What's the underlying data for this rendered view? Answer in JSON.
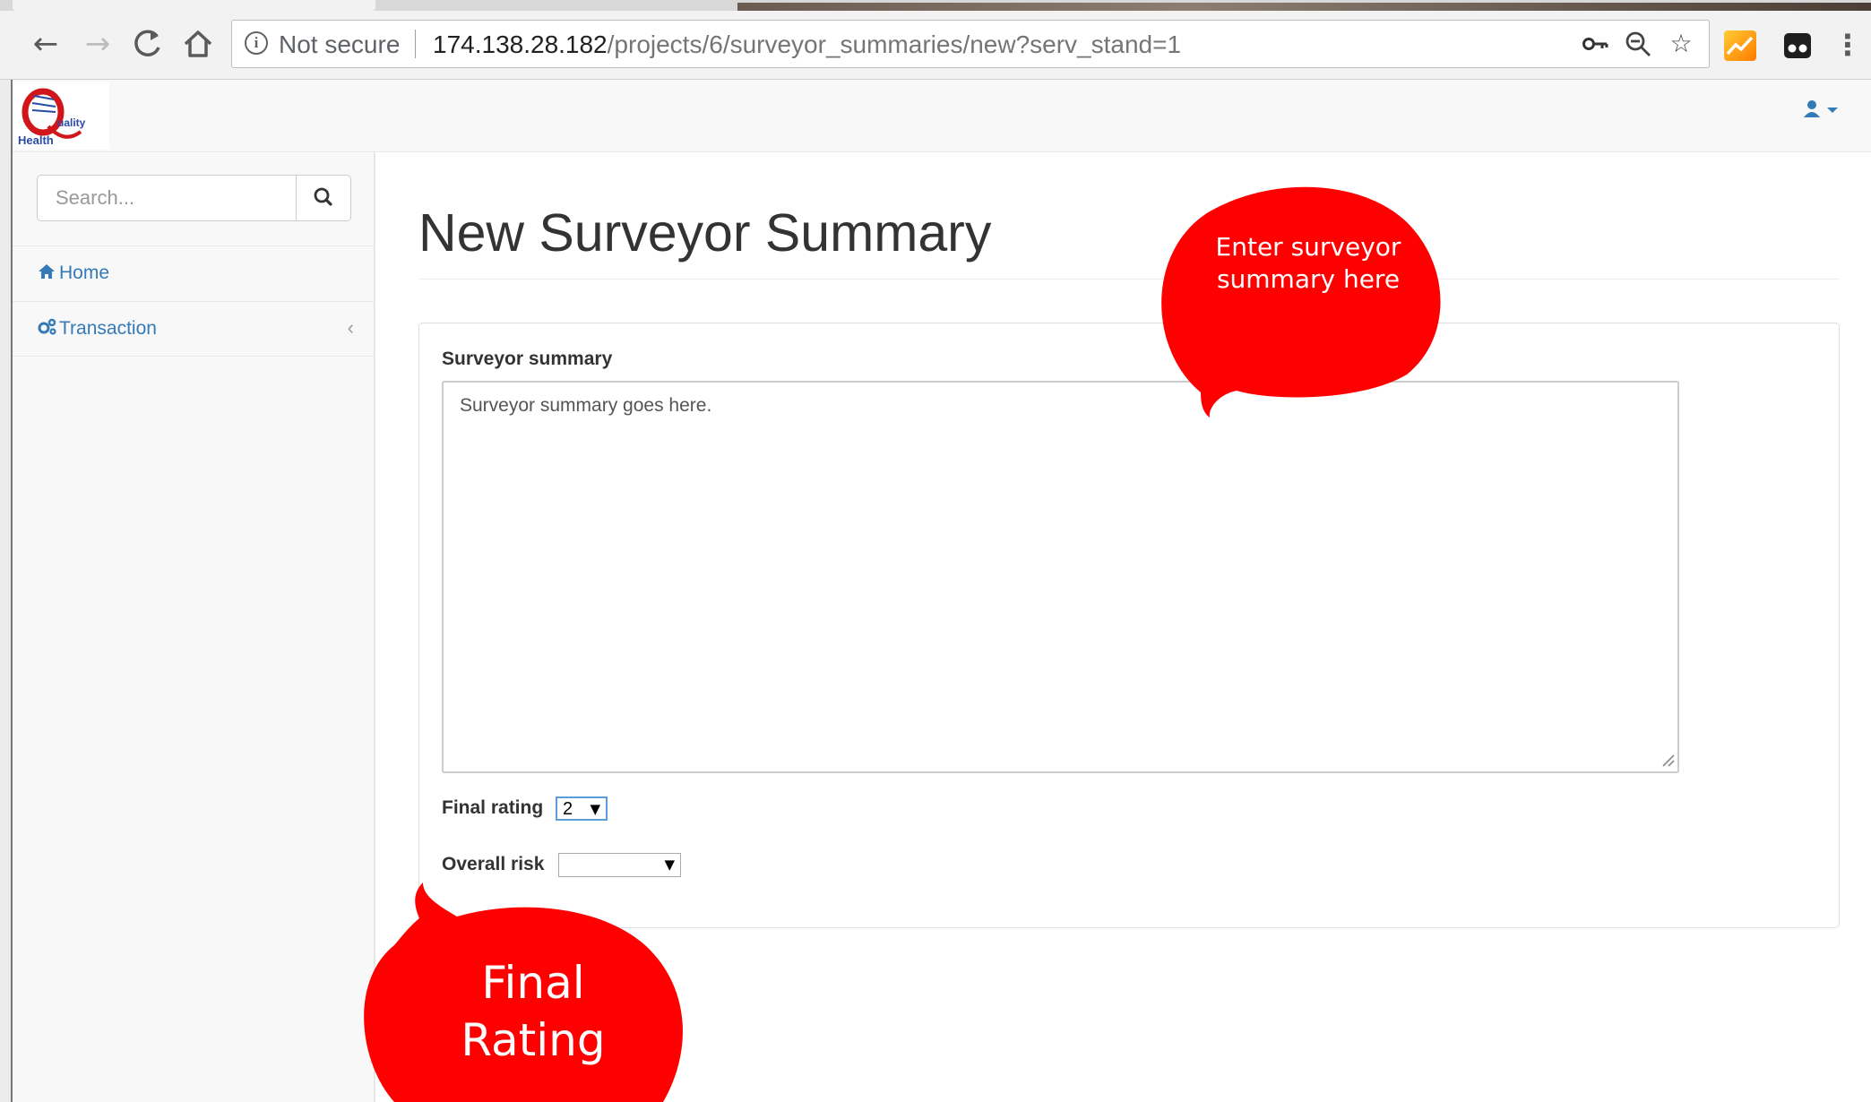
{
  "browser": {
    "security_label": "Not secure",
    "url_host": "174.138.28.182",
    "url_path": "/projects/6/surveyor_summaries/new?serv_stand=1",
    "icons": [
      "back-icon",
      "forward-icon",
      "reload-icon",
      "home-icon",
      "info-icon",
      "key-icon",
      "zoom-icon",
      "star-icon",
      "analytics-extension-icon",
      "incognito-extension-icon",
      "menu-icon"
    ]
  },
  "header": {
    "logo_text": "Quality Health",
    "user_icon": "user-icon"
  },
  "sidebar": {
    "search_placeholder": "Search...",
    "nav": [
      {
        "label": "Home",
        "icon": "home-icon"
      },
      {
        "label": "Transaction",
        "icon": "gears-icon",
        "chevron": "‹"
      }
    ]
  },
  "main": {
    "title": "New Surveyor Summary",
    "form": {
      "summary_label": "Surveyor summary",
      "summary_value": "Surveyor summary goes here.",
      "final_rating_label": "Final rating",
      "final_rating_value": "2",
      "overall_risk_label": "Overall risk",
      "overall_risk_value": ""
    }
  },
  "annotations": [
    {
      "text": "Enter surveyor summary here"
    },
    {
      "text": "Final Rating"
    }
  ],
  "colors": {
    "link": "#337ab7",
    "callout": "#ff0000"
  }
}
